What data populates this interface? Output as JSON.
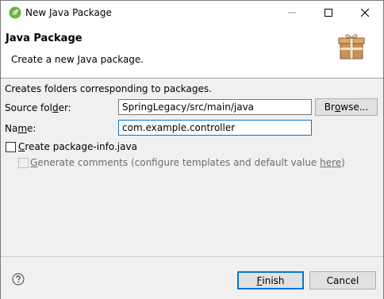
{
  "window": {
    "title": "New Java Package",
    "controls": {
      "minimize": "—",
      "maximize": "☐",
      "close": "✕"
    }
  },
  "header": {
    "title": "Java Package",
    "subtitle": "Create a new Java package."
  },
  "form": {
    "description": "Creates folders corresponding to packages.",
    "source_folder": {
      "label_pre": "Source fol",
      "label_mnemonic": "d",
      "label_post": "er:",
      "value": "SpringLegacy/src/main/java",
      "browse_pre": "Br",
      "browse_mnemonic": "o",
      "browse_post": "wse..."
    },
    "name": {
      "label_pre": "Na",
      "label_mnemonic": "m",
      "label_post": "e:",
      "value": "com.example.controller"
    },
    "create_package_info": {
      "mnemonic": "C",
      "label_post": "reate package-info.java",
      "checked": false
    },
    "generate_comments": {
      "mnemonic": "G",
      "label_mid": "enerate comments (configure templates and default value ",
      "link": "here",
      "label_end": ")",
      "checked": false,
      "enabled": false
    }
  },
  "footer": {
    "finish_mnemonic": "F",
    "finish_post": "inish",
    "cancel_label": "Cancel"
  },
  "colors": {
    "accent": "#0078d7",
    "spring_green": "#6db33f",
    "gift_box": "#c9925a"
  }
}
